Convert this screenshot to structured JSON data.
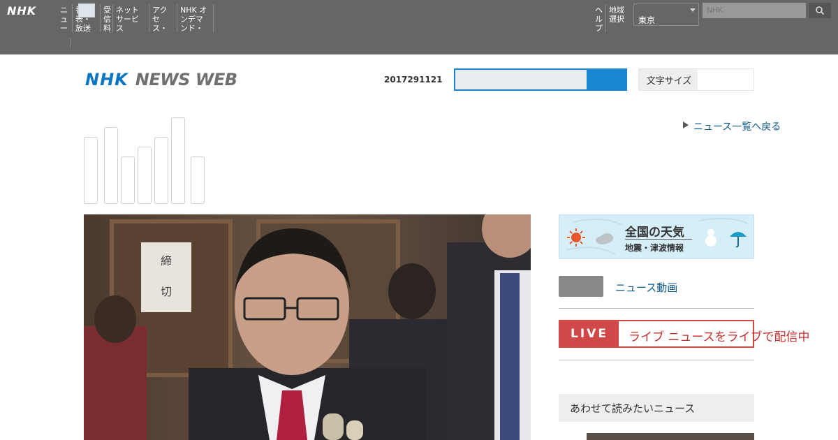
{
  "global_bar": {
    "logo": "NHK",
    "nav_left": [
      "ニュース",
      "番組表・放送予定",
      "受信料",
      "ネットサービス",
      "アクセス・地図",
      "NHK オンデマンド・見逃し"
    ],
    "nav_right": [
      "ヘルプ",
      "地域選択"
    ],
    "region_select": "東京",
    "search_placeholder": "NHK",
    "search_icon": "search-icon"
  },
  "header": {
    "logo_nhk": "NHK",
    "logo_newsweb": "NEWS WEB",
    "date": "2017291121",
    "search_value": "",
    "toggle_label": "文字サイズ"
  },
  "top_link": "ニュース一覧へ戻る",
  "weather_banner": {
    "title": "全国の天気",
    "subtitle": "地震・津波情報"
  },
  "badge_link": "ニュース動画",
  "live": {
    "tag": "LIVE",
    "text": "ライブ ニュースをライブで配信中"
  },
  "side_section": {
    "title": "あわせて読みたいニュース"
  },
  "colors": {
    "brand_blue": "#0b77c4",
    "live_red": "#d04848",
    "topbar_gray": "#666666"
  }
}
